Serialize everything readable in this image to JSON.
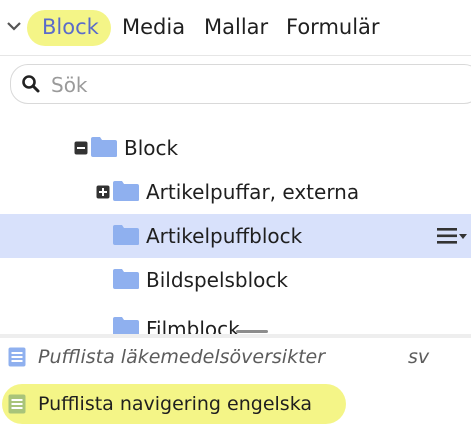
{
  "tabs": [
    {
      "label": "Block"
    },
    {
      "label": "Media"
    },
    {
      "label": "Mallar"
    },
    {
      "label": "Formulär"
    }
  ],
  "search": {
    "placeholder": "Sök",
    "value": ""
  },
  "tree": {
    "items": [
      {
        "label": "Block",
        "toggle": "collapse"
      },
      {
        "label": "Artikelpuffar, externa",
        "toggle": "expand"
      },
      {
        "label": "Artikelpuffblock",
        "selected": true
      },
      {
        "label": "Bildspelsblock"
      },
      {
        "label": "Filmblock"
      }
    ]
  },
  "list": {
    "items": [
      {
        "label": "Pufflista läkemedelsöversikter",
        "lang": "sv"
      },
      {
        "label": "Pufflista navigering engelska",
        "lang": ""
      }
    ]
  },
  "colors": {
    "accent": "#5b6cc9",
    "selected_row": "#d8e1fb",
    "highlight": "#f3f47a",
    "folder": "#8fb0ef"
  }
}
